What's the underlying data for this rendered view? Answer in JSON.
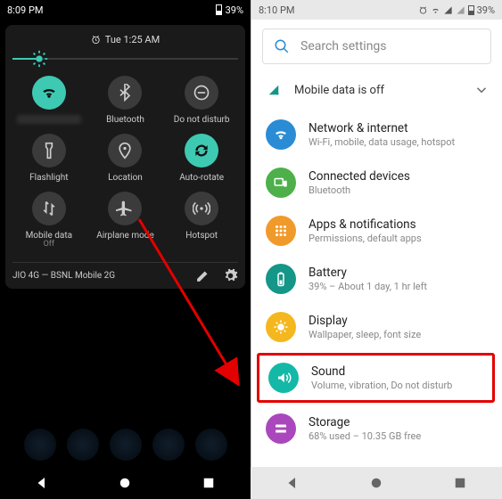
{
  "left": {
    "status": {
      "time": "8:09 PM",
      "battery": "39%"
    },
    "panel_time": "Tue 1:25 AM",
    "tiles": [
      {
        "label": "",
        "sublabel": "",
        "icon": "wifi",
        "on": true,
        "blurred": true
      },
      {
        "label": "Bluetooth",
        "sublabel": "",
        "icon": "bluetooth",
        "on": false
      },
      {
        "label": "Do not disturb",
        "sublabel": "",
        "icon": "dnd",
        "on": false
      },
      {
        "label": "Flashlight",
        "sublabel": "",
        "icon": "flashlight",
        "on": false
      },
      {
        "label": "Location",
        "sublabel": "",
        "icon": "location",
        "on": false
      },
      {
        "label": "Auto-rotate",
        "sublabel": "",
        "icon": "rotate",
        "on": true
      },
      {
        "label": "Mobile data",
        "sublabel": "Off",
        "icon": "data",
        "on": false
      },
      {
        "label": "Airplane mode",
        "sublabel": "",
        "icon": "airplane",
        "on": false
      },
      {
        "label": "Hotspot",
        "sublabel": "",
        "icon": "hotspot",
        "on": false
      }
    ],
    "carrier": "JIO 4G — BSNL Mobile 2G"
  },
  "right": {
    "status": {
      "time": "8:10 PM",
      "battery": "39%"
    },
    "search_placeholder": "Search settings",
    "banner": "Mobile data is off",
    "items": [
      {
        "title": "Network & internet",
        "sub": "Wi-Fi, mobile, data usage, hotspot",
        "color": "bg-blue",
        "icon": "wifi"
      },
      {
        "title": "Connected devices",
        "sub": "Bluetooth",
        "color": "bg-green",
        "icon": "devices"
      },
      {
        "title": "Apps & notifications",
        "sub": "Permissions, default apps",
        "color": "bg-orange",
        "icon": "apps"
      },
      {
        "title": "Battery",
        "sub": "39% – About 1 day, 1 hr left",
        "color": "bg-teal",
        "icon": "battery"
      },
      {
        "title": "Display",
        "sub": "Wallpaper, sleep, font size",
        "color": "bg-yellow",
        "icon": "display"
      },
      {
        "title": "Sound",
        "sub": "Volume, vibration, Do not disturb",
        "color": "bg-tealcyan",
        "icon": "sound",
        "highlight": true
      },
      {
        "title": "Storage",
        "sub": "68% used – 10.35 GB free",
        "color": "bg-purple",
        "icon": "storage"
      }
    ]
  }
}
